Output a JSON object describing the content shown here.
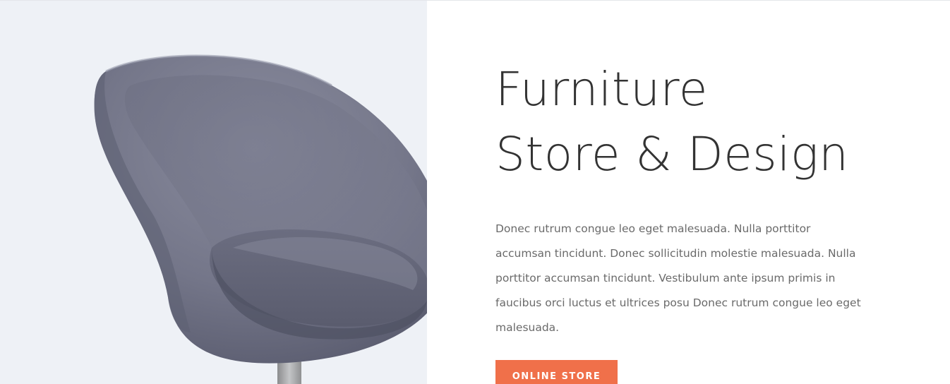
{
  "hero": {
    "title_line1": "Furniture",
    "title_line2": "Store & Design",
    "description": "Donec rutrum congue leo eget malesuada. Nulla porttitor accumsan tincidunt. Donec sollicitudin molestie malesuada. Nulla porttitor accumsan tincidunt. Vestibulum ante ipsum primis in faucibus orci luctus et ultrices posu Donec rutrum congue leo eget malesuada.",
    "cta_label": "ONLINE STORE"
  },
  "colors": {
    "accent": "#f0704a",
    "image_panel_bg": "#eef1f6",
    "chair_fabric": "#75778a",
    "title_text": "#333333",
    "body_text": "#6a6a6a"
  },
  "image": {
    "subject": "grey-fabric-armchair"
  }
}
